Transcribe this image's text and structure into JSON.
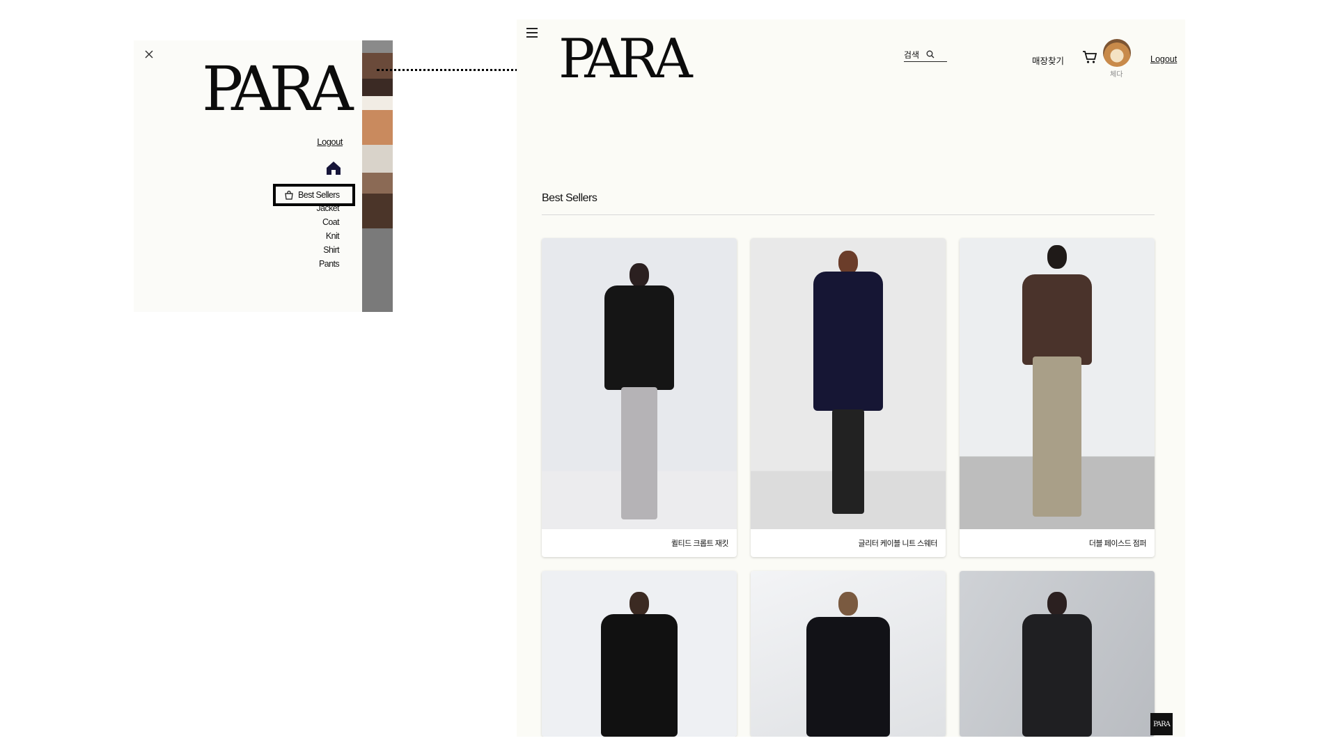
{
  "drawer": {
    "logo": "PARA",
    "logout_label": "Logout",
    "active_item": "Best Sellers",
    "menu_items": [
      "Jacket",
      "Coat",
      "Knit",
      "Shirt",
      "Pants"
    ]
  },
  "header": {
    "logo": "PARA",
    "search_label": "검색",
    "store_finder_label": "매장찾기",
    "user_name": "체다",
    "logout_label": "Logout"
  },
  "main": {
    "section_title": "Best Sellers",
    "products": [
      {
        "name": "퀼티드 크롭트 재킷"
      },
      {
        "name": "글리터 케이블 니트 스웨터"
      },
      {
        "name": "더블 페이스드 점퍼"
      },
      {
        "name": ""
      },
      {
        "name": ""
      },
      {
        "name": ""
      }
    ]
  },
  "badge": "PARA",
  "icons": [
    "close-icon",
    "home-icon",
    "shopping-bag-icon",
    "hamburger-icon",
    "search-icon",
    "cart-icon"
  ],
  "colors": {
    "page_bg": "#fbfbf6",
    "text": "#111111",
    "accent": "#000000"
  }
}
